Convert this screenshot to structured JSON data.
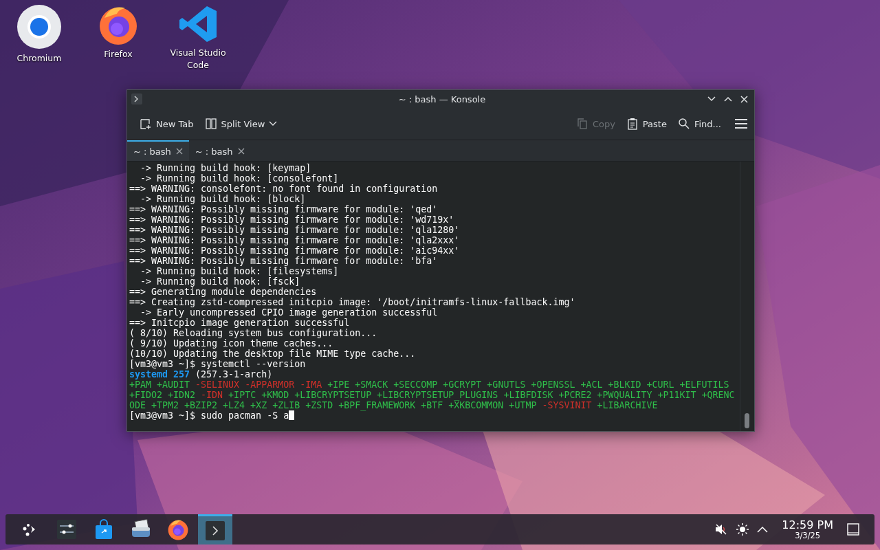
{
  "desktop_icons": [
    {
      "kind": "chromium",
      "label": "Chromium"
    },
    {
      "kind": "firefox",
      "label": "Firefox"
    },
    {
      "kind": "editor",
      "label": "Visual Studio Code"
    }
  ],
  "window": {
    "title": "~ : bash — Konsole"
  },
  "toolbar": [
    {
      "kind": "newtab",
      "label": "New Tab",
      "disabled": false
    },
    {
      "kind": "split",
      "label": "Split View",
      "disabled": false
    },
    {
      "kind": "copy",
      "label": "Copy",
      "disabled": true
    },
    {
      "kind": "paste",
      "label": "Paste",
      "disabled": false
    },
    {
      "kind": "find",
      "label": "Find...",
      "disabled": false
    }
  ],
  "tabs": [
    {
      "label": "~ : bash",
      "selected": true
    },
    {
      "label": "~ : bash",
      "selected": false
    }
  ],
  "terminal": {
    "lines": [
      {
        "text": "  -> Running build hook: [keymap]"
      },
      {
        "text": "  -> Running build hook: [consolefont]"
      },
      {
        "text": "==> WARNING: consolefont: no font found in configuration"
      },
      {
        "text": "  -> Running build hook: [block]"
      },
      {
        "text": "==> WARNING: Possibly missing firmware for module: 'qed'"
      },
      {
        "text": "==> WARNING: Possibly missing firmware for module: 'wd719x'"
      },
      {
        "text": "==> WARNING: Possibly missing firmware for module: 'qla1280'"
      },
      {
        "text": "==> WARNING: Possibly missing firmware for module: 'qla2xxx'"
      },
      {
        "text": "==> WARNING: Possibly missing firmware for module: 'aic94xx'"
      },
      {
        "text": "==> WARNING: Possibly missing firmware for module: 'bfa'"
      },
      {
        "text": "  -> Running build hook: [filesystems]"
      },
      {
        "text": "  -> Running build hook: [fsck]"
      },
      {
        "text": "==> Generating module dependencies"
      },
      {
        "text": "==> Creating zstd-compressed initcpio image: '/boot/initramfs-linux-fallback.img'"
      },
      {
        "text": "  -> Early uncompressed CPIO image generation successful"
      },
      {
        "text": "==> Initcpio image generation successful"
      },
      {
        "text": "( 8/10) Reloading system bus configuration..."
      },
      {
        "text": "( 9/10) Updating icon theme caches..."
      },
      {
        "text": "(10/10) Updating the desktop file MIME type cache..."
      },
      {
        "text": "[vm3@vm3 ~]$ systemctl --version"
      },
      {
        "segments": [
          {
            "text": "systemd 257",
            "color": "#1d99f3"
          },
          {
            "text": " (257.3-1-arch)",
            "color": "#fcfcfc"
          }
        ]
      },
      {
        "segments": [
          {
            "text": "+PAM +AUDIT ",
            "color": "#2fbf4a"
          },
          {
            "text": "-SELINUX -APPARMOR -IMA",
            "color": "#d0302a"
          },
          {
            "text": " +IPE +SMACK +SECCOMP +GCRYPT +GNUTLS +OPENSSL +ACL +BLKID +CURL +ELFUTILS",
            "color": "#2fbf4a"
          }
        ]
      },
      {
        "segments": [
          {
            "text": "+FIDO2 +IDN2 ",
            "color": "#2fbf4a"
          },
          {
            "text": "-IDN",
            "color": "#d0302a"
          },
          {
            "text": " +IPTC +KMOD +LIBCRYPTSETUP +LIBCRYPTSETUP_PLUGINS +LIBFDISK +PCRE2 +PWQUALITY +P11KIT +QRENC",
            "color": "#2fbf4a"
          }
        ]
      },
      {
        "segments": [
          {
            "text": "ODE +TPM2 +BZIP2 +LZ4 +XZ +ZLIB +ZSTD +BPF_FRAMEWORK +BTF +XKBCOMMON +UTMP ",
            "color": "#2fbf4a"
          },
          {
            "text": "-SYSVINIT",
            "color": "#d0302a"
          },
          {
            "text": " +LIBARCHIVE",
            "color": "#2fbf4a"
          }
        ]
      },
      {
        "text": "[vm3@vm3 ~]$ sudo pacman -S a",
        "cursor": true
      }
    ]
  },
  "taskbar": {
    "apps": [
      {
        "kind": "launcher",
        "selected": false
      },
      {
        "kind": "settings",
        "selected": false
      },
      {
        "kind": "store",
        "selected": false
      },
      {
        "kind": "scanner",
        "selected": false
      },
      {
        "kind": "firefox",
        "selected": false
      },
      {
        "kind": "terminal",
        "selected": true
      }
    ],
    "clock": {
      "time": "12:59 PM",
      "date": "3/3/25"
    }
  }
}
